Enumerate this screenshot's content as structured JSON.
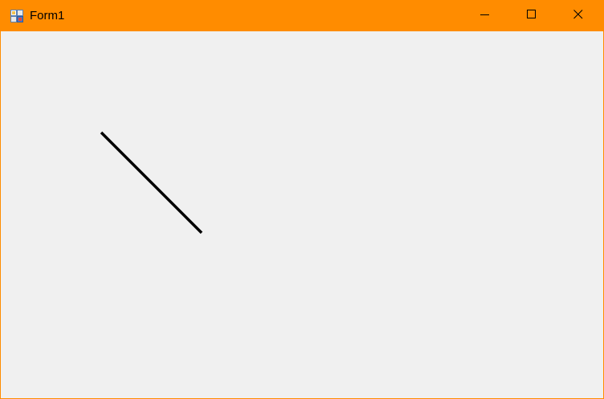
{
  "window": {
    "title": "Form1",
    "titlebar_color": "#ff8c00",
    "client_color": "#f0f0f0",
    "icon": "winforms-app-icon"
  },
  "caption_buttons": [
    {
      "name": "minimize",
      "icon": "minimize-icon"
    },
    {
      "name": "maximize",
      "icon": "maximize-icon"
    },
    {
      "name": "close",
      "icon": "close-icon"
    }
  ],
  "canvas": {
    "shapes": [
      {
        "type": "line",
        "color": "#000000"
      }
    ]
  }
}
